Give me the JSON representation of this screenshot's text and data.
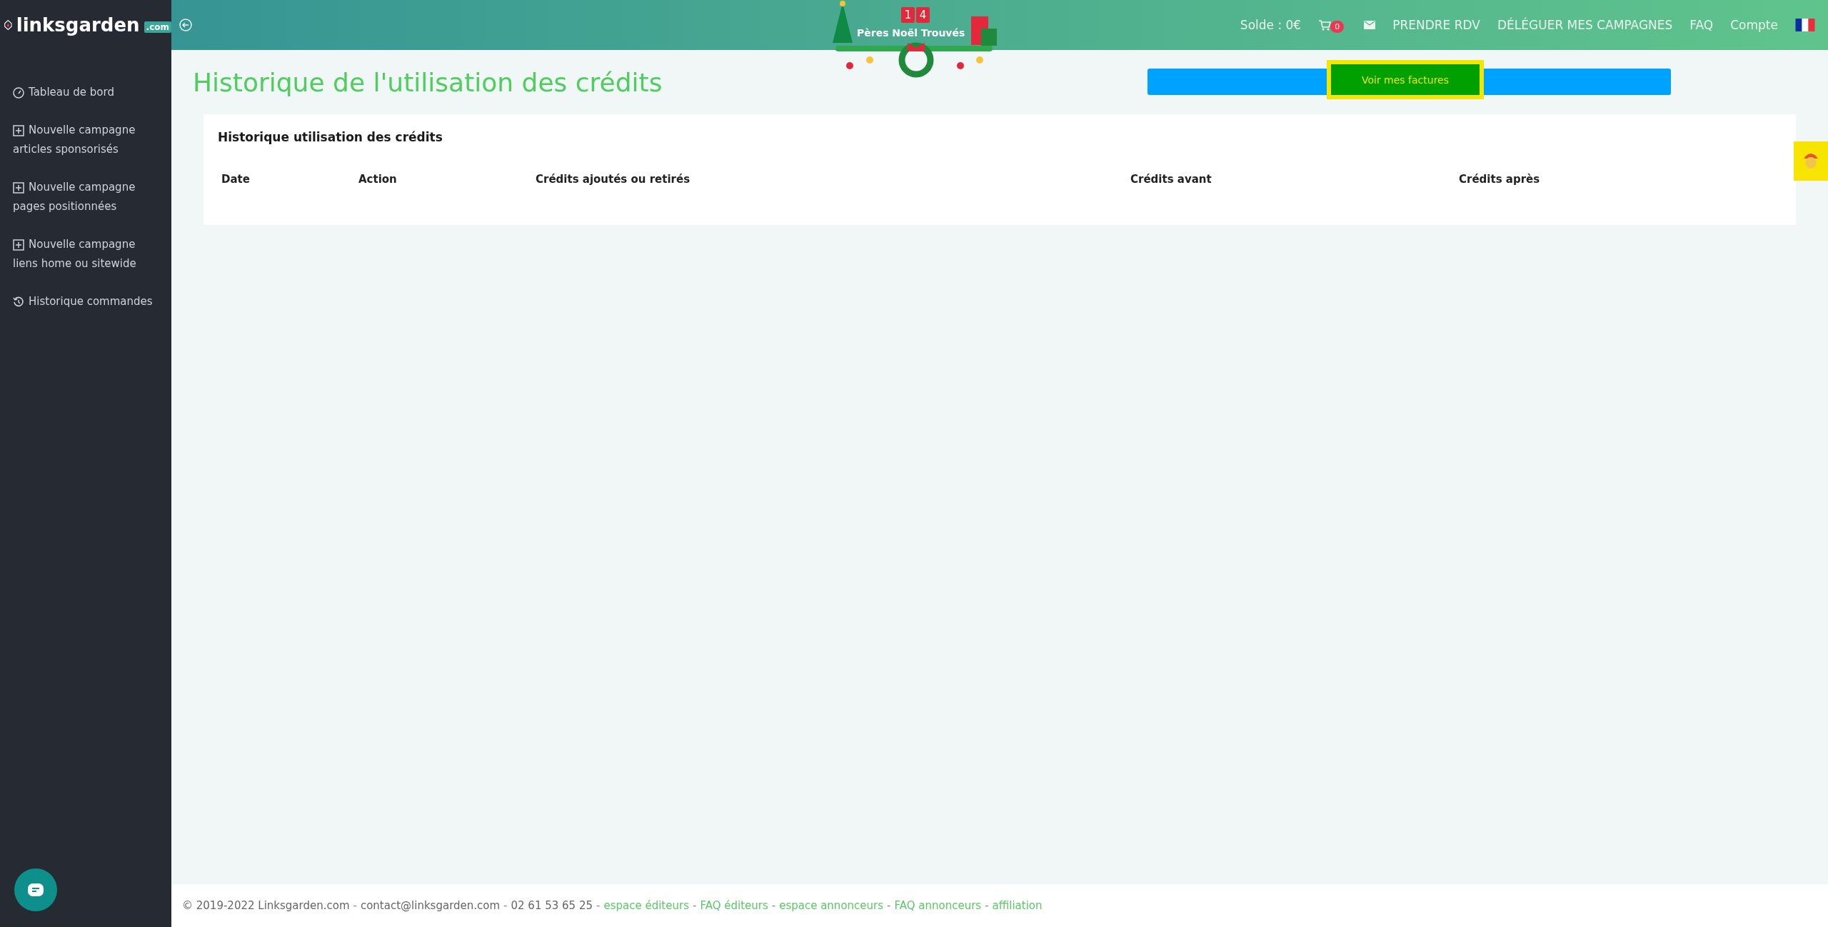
{
  "brand": {
    "name": "linksgarden",
    "tld": ".com"
  },
  "sidebar": {
    "items": [
      {
        "kind": "dashboard",
        "lines": [
          "Tableau de bord"
        ]
      },
      {
        "kind": "add",
        "lines": [
          "Nouvelle campagne",
          "articles sponsorisés"
        ]
      },
      {
        "kind": "add",
        "lines": [
          "Nouvelle campagne",
          "pages positionnées"
        ]
      },
      {
        "kind": "add",
        "lines": [
          "Nouvelle campagne",
          "liens home ou sitewide"
        ]
      },
      {
        "kind": "history",
        "lines": [
          "Historique commandes"
        ]
      }
    ]
  },
  "banner": {
    "counter": [
      "1",
      "4"
    ],
    "caption": "Pères Noël Trouvés"
  },
  "header": {
    "balance": "Solde : 0€",
    "cart_count": "0",
    "links": [
      "PRENDRE RDV",
      "DÉLÉGUER MES CAMPAGNES",
      "FAQ",
      "Compte"
    ]
  },
  "page": {
    "title": "Historique de l'utilisation des crédits",
    "invoices_button": "Voir mes factures"
  },
  "card": {
    "title": "Historique utilisation des crédits",
    "columns": [
      "Date",
      "Action",
      "Crédits ajoutés ou retirés",
      "Crédits avant",
      "Crédits après"
    ]
  },
  "footer": {
    "parts": [
      {
        "kind": "text",
        "text": "© 2019-2022 Linksgarden.com"
      },
      {
        "kind": "sep",
        "text": "-"
      },
      {
        "kind": "text",
        "text": "contact@linksgarden.com"
      },
      {
        "kind": "sep",
        "text": "-"
      },
      {
        "kind": "text",
        "text": "02 61 53 65 25"
      },
      {
        "kind": "sep",
        "text": "-"
      },
      {
        "kind": "link",
        "text": "espace éditeurs"
      },
      {
        "kind": "sep",
        "text": "-"
      },
      {
        "kind": "link",
        "text": "FAQ éditeurs"
      },
      {
        "kind": "sep",
        "text": "-"
      },
      {
        "kind": "link",
        "text": "espace annonceurs"
      },
      {
        "kind": "sep",
        "text": "-"
      },
      {
        "kind": "link",
        "text": "FAQ annonceurs"
      },
      {
        "kind": "sep",
        "text": "-"
      },
      {
        "kind": "link",
        "text": "affiliation"
      }
    ]
  }
}
